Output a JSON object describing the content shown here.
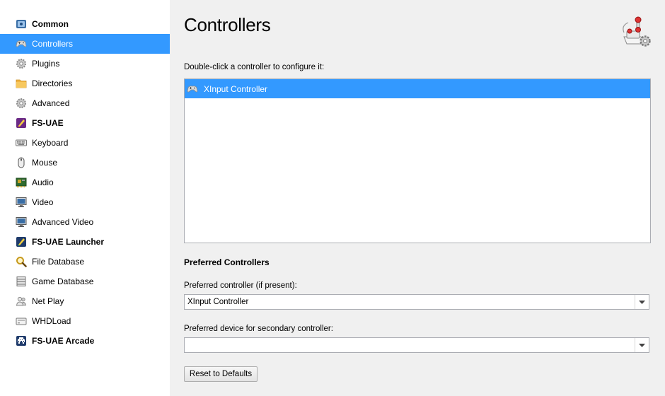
{
  "sidebar": {
    "items": [
      {
        "label": "Common",
        "icon": "common-icon",
        "bold": true
      },
      {
        "label": "Controllers",
        "icon": "gamepad-icon",
        "bold": false,
        "selected": true
      },
      {
        "label": "Plugins",
        "icon": "gear-icon",
        "bold": false
      },
      {
        "label": "Directories",
        "icon": "folder-icon",
        "bold": false
      },
      {
        "label": "Advanced",
        "icon": "gear-icon",
        "bold": false
      },
      {
        "label": "FS-UAE",
        "icon": "fsuae-icon",
        "bold": true
      },
      {
        "label": "Keyboard",
        "icon": "keyboard-icon",
        "bold": false
      },
      {
        "label": "Mouse",
        "icon": "mouse-icon",
        "bold": false
      },
      {
        "label": "Audio",
        "icon": "audio-card-icon",
        "bold": false
      },
      {
        "label": "Video",
        "icon": "monitor-icon",
        "bold": false
      },
      {
        "label": "Advanced Video",
        "icon": "monitor-icon",
        "bold": false
      },
      {
        "label": "FS-UAE Launcher",
        "icon": "fsuae-icon",
        "bold": true
      },
      {
        "label": "File Database",
        "icon": "magnifier-icon",
        "bold": false
      },
      {
        "label": "Game Database",
        "icon": "database-icon",
        "bold": false
      },
      {
        "label": "Net Play",
        "icon": "people-icon",
        "bold": false
      },
      {
        "label": "WHDLoad",
        "icon": "whdload-icon",
        "bold": false
      },
      {
        "label": "FS-UAE Arcade",
        "icon": "arcade-icon",
        "bold": true
      }
    ]
  },
  "main": {
    "title": "Controllers",
    "header_icon": "joystick-icon",
    "hint": "Double-click a controller to configure it:",
    "controllers": [
      {
        "label": "XInput Controller",
        "icon": "gamepad-icon",
        "selected": true
      }
    ],
    "preferred_section_title": "Preferred Controllers",
    "preferred_label": "Preferred controller (if present):",
    "preferred_value": "XInput Controller",
    "secondary_label": "Preferred device for secondary controller:",
    "secondary_value": "",
    "reset_button": "Reset to Defaults"
  },
  "colors": {
    "selection": "#3399ff",
    "sidebar_bg": "#ffffff",
    "panel_bg": "#f0f0f0"
  }
}
